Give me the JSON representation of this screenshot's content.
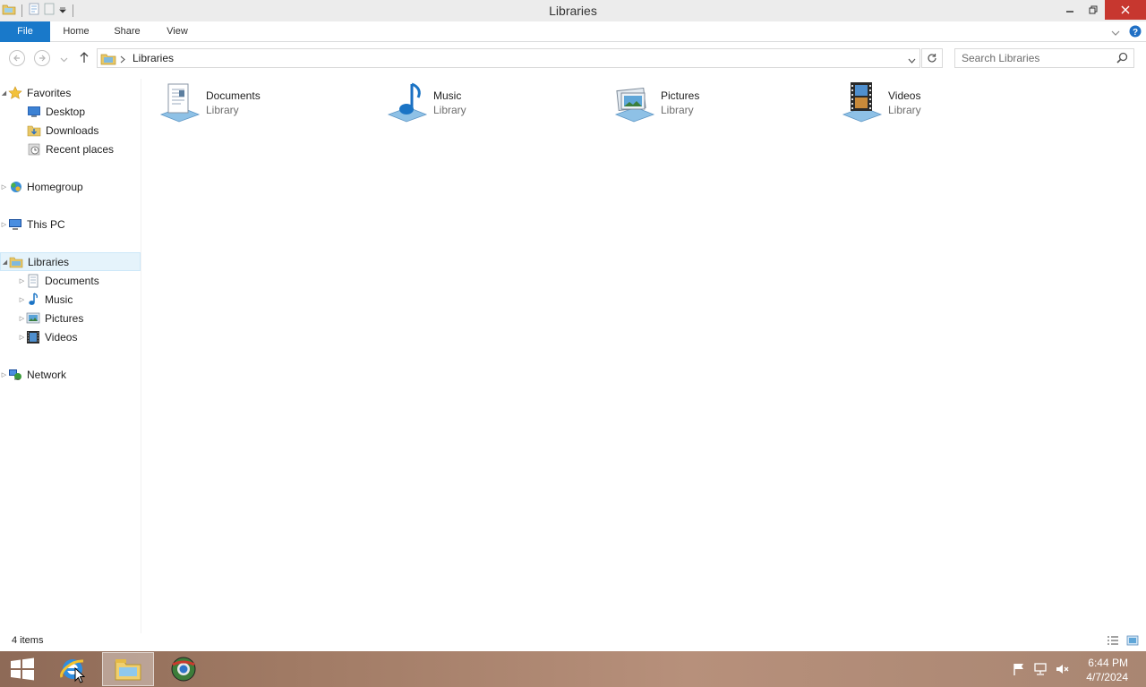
{
  "window": {
    "title": "Libraries"
  },
  "ribbon": {
    "tabs": [
      "File",
      "Home",
      "Share",
      "View"
    ]
  },
  "address": {
    "path": "Libraries"
  },
  "search": {
    "placeholder": "Search Libraries"
  },
  "nav": {
    "favorites": {
      "label": "Favorites",
      "items": [
        "Desktop",
        "Downloads",
        "Recent places"
      ]
    },
    "homegroup": "Homegroup",
    "thispc": "This PC",
    "libraries": {
      "label": "Libraries",
      "items": [
        "Documents",
        "Music",
        "Pictures",
        "Videos"
      ]
    },
    "network": "Network"
  },
  "tiles": [
    {
      "name": "Documents",
      "sub": "Library",
      "icon": "documents-library-icon"
    },
    {
      "name": "Music",
      "sub": "Library",
      "icon": "music-library-icon"
    },
    {
      "name": "Pictures",
      "sub": "Library",
      "icon": "pictures-library-icon"
    },
    {
      "name": "Videos",
      "sub": "Library",
      "icon": "videos-library-icon"
    }
  ],
  "status": {
    "count": "4 items"
  },
  "taskbar": {
    "apps": [
      "start-icon",
      "internet-explorer-icon",
      "file-explorer-icon",
      "browser-icon"
    ],
    "time": "6:44 PM",
    "date": "4/7/2024"
  },
  "colors": {
    "accent": "#1979ca",
    "close": "#c7372f",
    "selection": "#e5f3fb"
  }
}
